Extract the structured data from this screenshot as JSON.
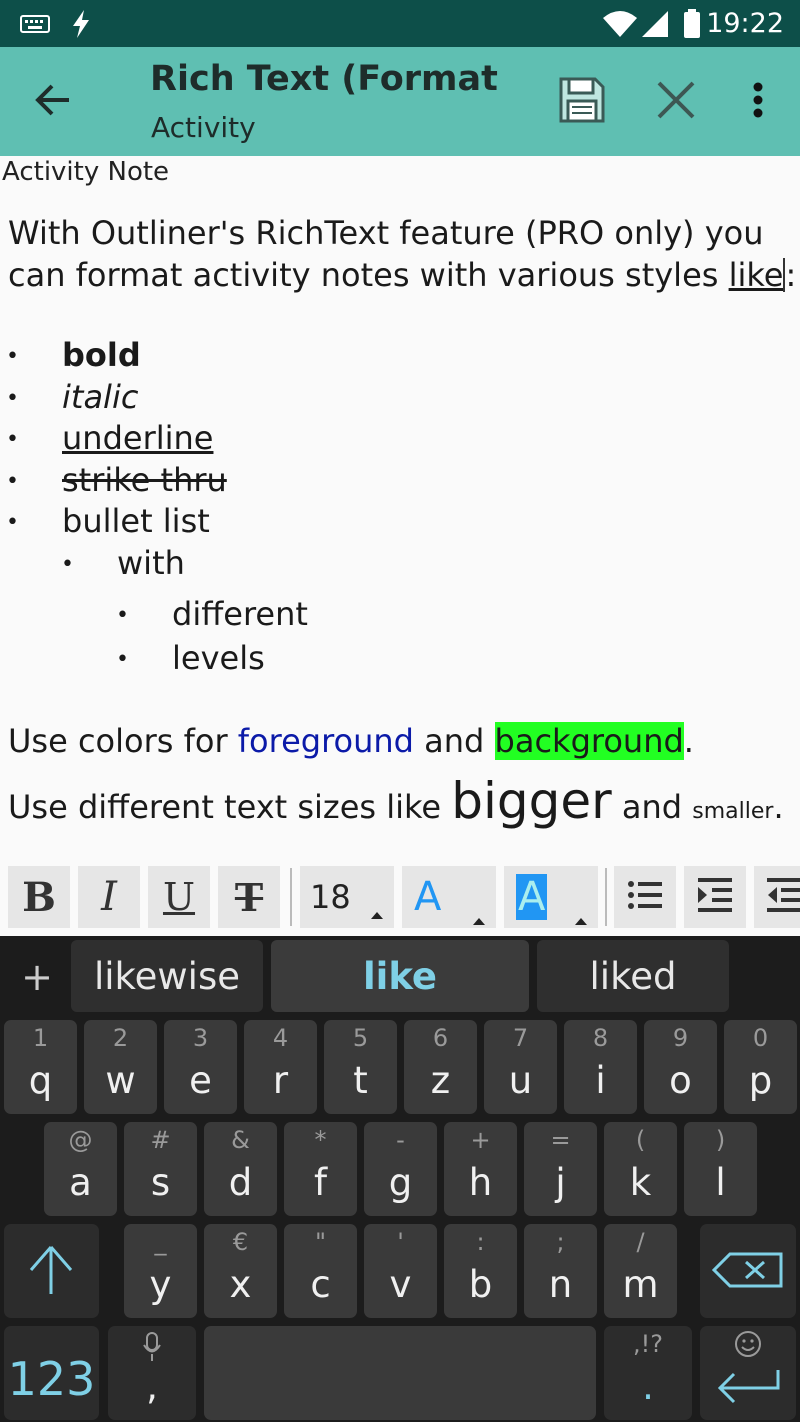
{
  "status_bar": {
    "time": "19:22",
    "icons": [
      "keyboard-icon",
      "flash-icon",
      "wifi-icon",
      "signal-icon",
      "battery-icon"
    ]
  },
  "app_bar": {
    "title": "Rich Text (Format",
    "subtitle": "Activity",
    "actions": [
      "back-arrow-icon",
      "save-icon",
      "close-icon",
      "more-vert-icon"
    ]
  },
  "note": {
    "label": "Activity Note",
    "intro_part1": "With Outliner's RichText feature (PRO only) you can format activity notes with various styles ",
    "intro_like": "like",
    "intro_colon": ":",
    "list": [
      {
        "text": "bold",
        "style": "bold",
        "level": 0
      },
      {
        "text": "italic",
        "style": "italic",
        "level": 0
      },
      {
        "text": "underline",
        "style": "underline",
        "level": 0
      },
      {
        "text": "strike thru",
        "style": "strike",
        "level": 0
      },
      {
        "text": "bullet list",
        "style": "normal",
        "level": 0
      },
      {
        "text": "with",
        "style": "normal",
        "level": 1
      },
      {
        "text": "different",
        "style": "normal",
        "level": 2
      },
      {
        "text": "levels",
        "style": "normal",
        "level": 2
      }
    ],
    "colors_prefix": "Use colors for ",
    "colors_fg": "foreground",
    "colors_and": " and ",
    "colors_bg": "background",
    "colors_end": ".",
    "sizes_prefix": "Use different text sizes like ",
    "sizes_big": "bigger",
    "sizes_and": " and ",
    "sizes_small": "smaller",
    "sizes_end": ".",
    "colors": {
      "foreground": "#0b1aa8",
      "background": "#22ff22"
    }
  },
  "format_toolbar": {
    "bold": "B",
    "italic": "I",
    "underline": "U",
    "strike": "T",
    "font_size": "18",
    "fg_color": "A",
    "bg_color": "A",
    "icons": [
      "bullet-list-icon",
      "indent-icon",
      "outdent-icon"
    ]
  },
  "keyboard": {
    "suggestions": [
      "likewise",
      "like",
      "liked"
    ],
    "row1": [
      {
        "hint": "1",
        "key": "q"
      },
      {
        "hint": "2",
        "key": "w"
      },
      {
        "hint": "3",
        "key": "e"
      },
      {
        "hint": "4",
        "key": "r"
      },
      {
        "hint": "5",
        "key": "t"
      },
      {
        "hint": "6",
        "key": "z"
      },
      {
        "hint": "7",
        "key": "u"
      },
      {
        "hint": "8",
        "key": "i"
      },
      {
        "hint": "9",
        "key": "o"
      },
      {
        "hint": "0",
        "key": "p"
      }
    ],
    "row2": [
      {
        "hint": "@",
        "key": "a"
      },
      {
        "hint": "#",
        "key": "s"
      },
      {
        "hint": "&",
        "key": "d"
      },
      {
        "hint": "*",
        "key": "f"
      },
      {
        "hint": "-",
        "key": "g"
      },
      {
        "hint": "+",
        "key": "h"
      },
      {
        "hint": "=",
        "key": "j"
      },
      {
        "hint": "(",
        "key": "k"
      },
      {
        "hint": ")",
        "key": "l"
      }
    ],
    "row3": [
      {
        "hint": "_",
        "key": "y"
      },
      {
        "hint": "€",
        "key": "x"
      },
      {
        "hint": "\"",
        "key": "c"
      },
      {
        "hint": "'",
        "key": "v"
      },
      {
        "hint": ":",
        "key": "b"
      },
      {
        "hint": ";",
        "key": "n"
      },
      {
        "hint": "/",
        "key": "m"
      }
    ],
    "numbers_key": "123",
    "comma_key": ",",
    "period_hint": ",!?",
    "period_key": "."
  }
}
